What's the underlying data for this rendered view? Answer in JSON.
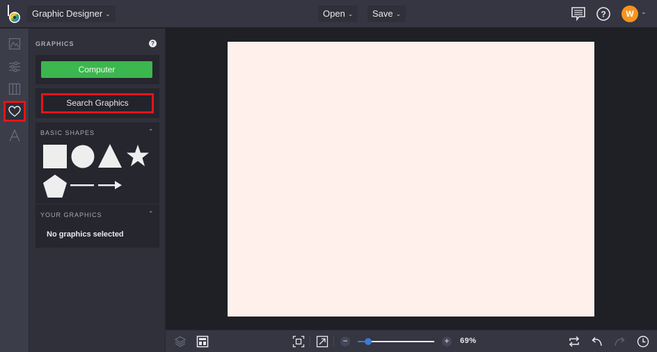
{
  "topbar": {
    "app_menu_label": "Graphic Designer",
    "open_label": "Open",
    "save_label": "Save",
    "user_initial": "W",
    "icons": [
      "logo-icon",
      "chat-icon",
      "help-icon",
      "avatar",
      "chevron-down-icon"
    ]
  },
  "iconrail": {
    "items": [
      {
        "name": "image",
        "icon": "image-icon",
        "active": false
      },
      {
        "name": "adjustments",
        "icon": "sliders-icon",
        "active": false
      },
      {
        "name": "layout",
        "icon": "columns-icon",
        "active": false
      },
      {
        "name": "graphics",
        "icon": "heart-icon",
        "active": true
      },
      {
        "name": "text",
        "icon": "text-icon",
        "active": false
      }
    ]
  },
  "panel": {
    "title": "GRAPHICS",
    "help": "?",
    "computer_button": "Computer",
    "search_button": "Search Graphics",
    "basic_shapes": {
      "title": "BASIC SHAPES",
      "chevron": "^",
      "shapes": [
        "square",
        "circle",
        "triangle",
        "star",
        "pentagon",
        "line",
        "arrow"
      ]
    },
    "your_graphics": {
      "title": "YOUR GRAPHICS",
      "chevron": "^",
      "empty_text": "No graphics selected"
    }
  },
  "canvas": {
    "background_color": "#fff0ec"
  },
  "bottombar": {
    "zoom_minus": "−",
    "zoom_plus": "+",
    "zoom_percent": 69,
    "zoom_label": "69%",
    "zoom_slider_fraction": 0.14,
    "icons": [
      "layers-icon",
      "layout-icon",
      "fit-screen-icon",
      "expand-icon",
      "swap-icon",
      "undo-icon",
      "redo-icon",
      "history-icon"
    ]
  },
  "colors": {
    "accent_green": "#3cb64e",
    "highlight_red": "#e4141b",
    "slider_blue": "#3a7bd5",
    "avatar_orange": "#f7931e"
  }
}
